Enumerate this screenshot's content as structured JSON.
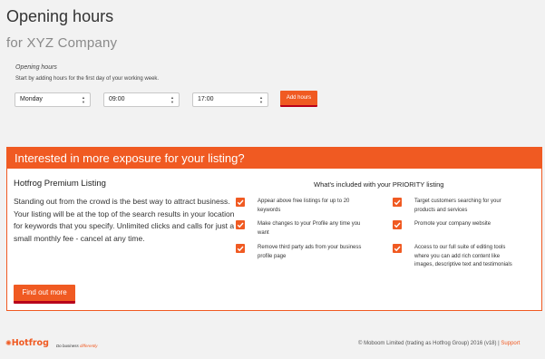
{
  "header": {
    "title": "Opening hours",
    "subtitle": "for XYZ Company"
  },
  "hours_form": {
    "label": "Opening hours",
    "description": "Start by adding hours for the first day of your working week.",
    "day_value": "Monday",
    "open_value": "09:00",
    "close_value": "17:00",
    "add_button_label": "Add hours"
  },
  "promo": {
    "heading": "Interested in more exposure for your listing?",
    "premium_title": "Hotfrog Premium Listing",
    "premium_text": "Standing out from the crowd is the best way to attract business. Your listing will be at the top of the search results in your location for keywords that you specify. Unlimited clicks and calls for just a small monthly fee - cancel at any time.",
    "find_button_label": "Find out more",
    "included_title": "What's included with your PRIORITY listing",
    "features_left": [
      "Appear above free listings for up to 20 keywords",
      "Make changes to your Profile any time you want",
      "Remove third party ads from your business profile page"
    ],
    "features_right": [
      "Target customers searching for your products and services",
      "Promote your company website",
      "Access to our full suite of editing tools where you can add rich content like images, descriptive text and testimonials"
    ]
  },
  "footer": {
    "logo_text": "Hotfrog",
    "tagline_prefix": "Do business ",
    "tagline_emphasis": "differently",
    "copyright": "© Moboom Limited (trading as Hotfrog Group) 2016 (v18) |",
    "support_label": "Support"
  },
  "colors": {
    "accent": "#f05a22",
    "accent_dark": "#b8001c",
    "background": "#f2f2f2"
  },
  "icons": {
    "check": "check-icon",
    "select_arrows": "updown-arrows-icon"
  }
}
